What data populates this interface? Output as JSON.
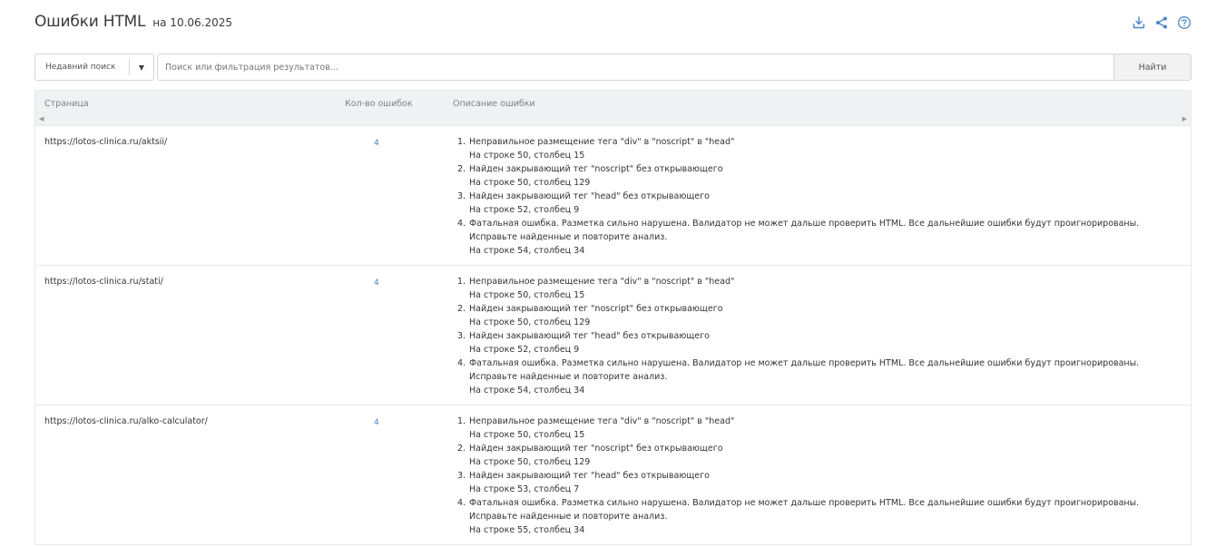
{
  "header": {
    "title": "Ошибки HTML",
    "subtitle": "на 10.06.2025"
  },
  "toolbar": {
    "icons": [
      "download-icon",
      "share-icon",
      "help-icon"
    ]
  },
  "search": {
    "recent_label": "Недавний поиск",
    "placeholder": "Поиск или фильтрация результатов...",
    "find_label": "Найти"
  },
  "table": {
    "columns": [
      "Страница",
      "Кол-во ошибок",
      "Описание ошибки"
    ],
    "rows": [
      {
        "page": "https://lotos-clinica.ru/aktsii/",
        "count": "4",
        "errors": [
          {
            "num": "1.",
            "text": "Неправильное размещение тега \"div\" в \"noscript\" в \"head\"",
            "location": "На строке 50, столбец 15"
          },
          {
            "num": "2.",
            "text": "Найден закрывающий тег \"noscript\" без открывающего",
            "location": "На строке 50, столбец 129"
          },
          {
            "num": "3.",
            "text": "Найден закрывающий тег \"head\" без открывающего",
            "location": "На строке 52, столбец 9"
          },
          {
            "num": "4.",
            "text": "Фатальная ошибка. Разметка сильно нарушена. Валидатор не может дальше проверить HTML. Все дальнейшие ошибки будут проигнорированы. Исправьте найденные и повторите анализ.",
            "location": "На строке 54, столбец 34"
          }
        ]
      },
      {
        "page": "https://lotos-clinica.ru/stati/",
        "count": "4",
        "errors": [
          {
            "num": "1.",
            "text": "Неправильное размещение тега \"div\" в \"noscript\" в \"head\"",
            "location": "На строке 50, столбец 15"
          },
          {
            "num": "2.",
            "text": "Найден закрывающий тег \"noscript\" без открывающего",
            "location": "На строке 50, столбец 129"
          },
          {
            "num": "3.",
            "text": "Найден закрывающий тег \"head\" без открывающего",
            "location": "На строке 52, столбец 9"
          },
          {
            "num": "4.",
            "text": "Фатальная ошибка. Разметка сильно нарушена. Валидатор не может дальше проверить HTML. Все дальнейшие ошибки будут проигнорированы. Исправьте найденные и повторите анализ.",
            "location": "На строке 54, столбец 34"
          }
        ]
      },
      {
        "page": "https://lotos-clinica.ru/alko-calculator/",
        "count": "4",
        "errors": [
          {
            "num": "1.",
            "text": "Неправильное размещение тега \"div\" в \"noscript\" в \"head\"",
            "location": "На строке 50, столбец 15"
          },
          {
            "num": "2.",
            "text": "Найден закрывающий тег \"noscript\" без открывающего",
            "location": "На строке 50, столбец 129"
          },
          {
            "num": "3.",
            "text": "Найден закрывающий тег \"head\" без открывающего",
            "location": "На строке 53, столбец 7"
          },
          {
            "num": "4.",
            "text": "Фатальная ошибка. Разметка сильно нарушена. Валидатор не может дальше проверить HTML. Все дальнейшие ошибки будут проигнорированы. Исправьте найденные и повторите анализ.",
            "location": "На строке 55, столбец 34"
          }
        ]
      }
    ]
  },
  "colors": {
    "accent": "#4a86c8",
    "header_bg": "#f0f1f3",
    "border": "#e7e8ea"
  }
}
